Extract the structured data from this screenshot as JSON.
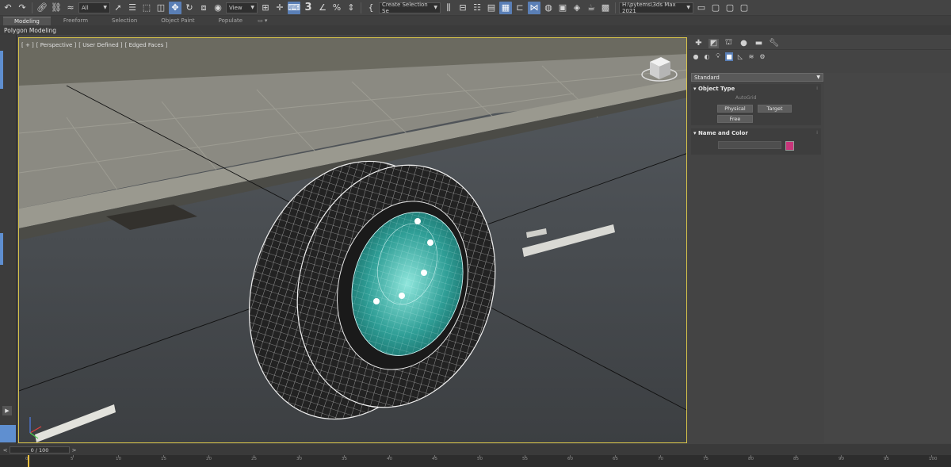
{
  "toolbar": {
    "selection_filter": "All",
    "coord_system": "View",
    "named_selection_placeholder": "Create Selection Se",
    "snap_value": "3",
    "workspace_path": "H:\\pytems\\3ds Max 2021"
  },
  "ribbon": {
    "tabs": [
      {
        "label": "Modeling",
        "active": true
      },
      {
        "label": "Freeform",
        "active": false
      },
      {
        "label": "Selection",
        "active": false
      },
      {
        "label": "Object Paint",
        "active": false
      },
      {
        "label": "Populate",
        "active": false
      }
    ],
    "panel_label": "Polygon Modeling"
  },
  "viewport": {
    "label_parts": [
      "[ + ]",
      "[ Perspective ]",
      "[ User Defined ]",
      "[ Edged Faces ]"
    ]
  },
  "command_panel": {
    "category": "Standard",
    "object_type": {
      "title": "Object Type",
      "autogrid": "AutoGrid",
      "buttons": [
        "Physical",
        "Target",
        "Free"
      ]
    },
    "name_and_color": {
      "title": "Name and Color",
      "swatch_color": "#c8357a"
    }
  },
  "timeline": {
    "frame_display": "0 / 100",
    "ticks": [
      "0",
      "5",
      "10",
      "15",
      "20",
      "25",
      "30",
      "35",
      "40",
      "45",
      "50",
      "55",
      "60",
      "65",
      "70",
      "75",
      "80",
      "85",
      "90",
      "95",
      "100"
    ]
  },
  "colors": {
    "accent": "#5a7fb6",
    "viewport_border": "#d8c44a",
    "rim": "#3fb7b0"
  }
}
